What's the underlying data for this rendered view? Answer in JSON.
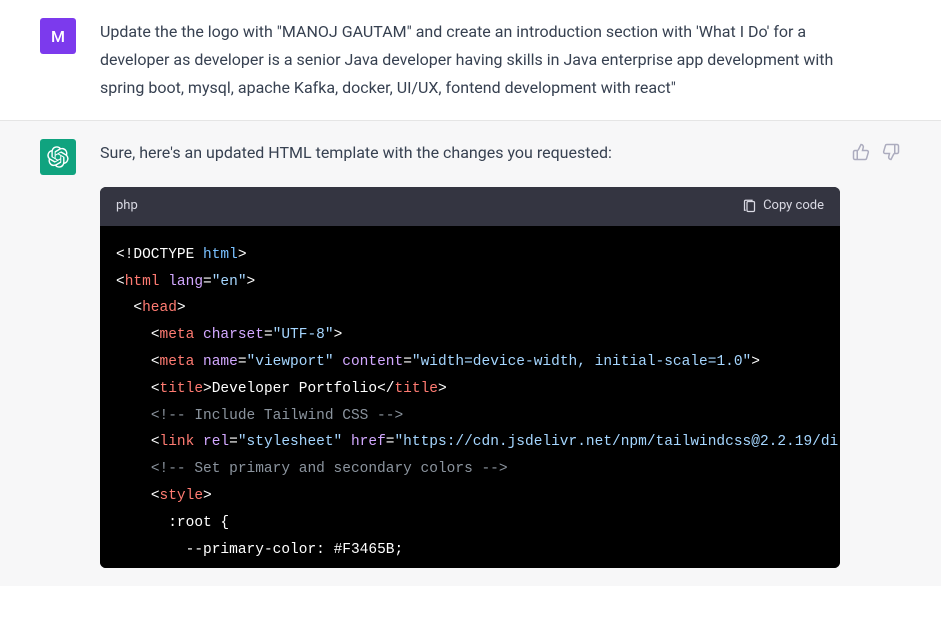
{
  "user": {
    "avatar_letter": "M",
    "message": "Update the the logo with \"MANOJ GAUTAM\"  and create an introduction section with 'What I Do'  for a developer as developer is a senior Java developer having skills in  Java enterprise app development with spring boot, mysql,  apache Kafka, docker, UI/UX, fontend development with react\""
  },
  "assistant": {
    "message": "Sure, here's an updated HTML template with the changes you requested:"
  },
  "code": {
    "language": "php",
    "copy_label": "Copy code",
    "lines": {
      "l1_open": "<!",
      "l1_doctype": "DOCTYPE",
      "l1_html": " html",
      "l1_close": ">",
      "l2_open": "<",
      "l2_tag": "html",
      "l2_attr": " lang",
      "l2_eq": "=",
      "l2_val": "\"en\"",
      "l2_close": ">",
      "l3_open": "<",
      "l3_tag": "head",
      "l3_close": ">",
      "l4_open": "<",
      "l4_tag": "meta",
      "l4_attr": " charset",
      "l4_eq": "=",
      "l4_val": "\"UTF-8\"",
      "l4_close": ">",
      "l5_open": "<",
      "l5_tag": "meta",
      "l5_attr1": " name",
      "l5_eq1": "=",
      "l5_val1": "\"viewport\"",
      "l5_attr2": " content",
      "l5_eq2": "=",
      "l5_val2": "\"width=device-width, initial-scale=1.0\"",
      "l5_close": ">",
      "l6_open": "<",
      "l6_tag": "title",
      "l6_close1": ">",
      "l6_text": "Developer Portfolio",
      "l6_open2": "</",
      "l6_tag2": "title",
      "l6_close2": ">",
      "l7_comment": "<!-- Include Tailwind CSS -->",
      "l8_open": "<",
      "l8_tag": "link",
      "l8_attr1": " rel",
      "l8_eq1": "=",
      "l8_val1": "\"stylesheet\"",
      "l8_attr2": " href",
      "l8_eq2": "=",
      "l8_val2": "\"https://cdn.jsdelivr.net/npm/tailwindcss@2.2.19/di",
      "l9_comment": "<!-- Set primary and secondary colors -->",
      "l10_open": "<",
      "l10_tag": "style",
      "l10_close": ">",
      "l11_sel": ":root",
      "l11_brace": " {",
      "l12_prop": "--primary-color",
      "l12_colon": ": ",
      "l12_val": "#F3465B",
      "l12_semi": ";"
    }
  }
}
